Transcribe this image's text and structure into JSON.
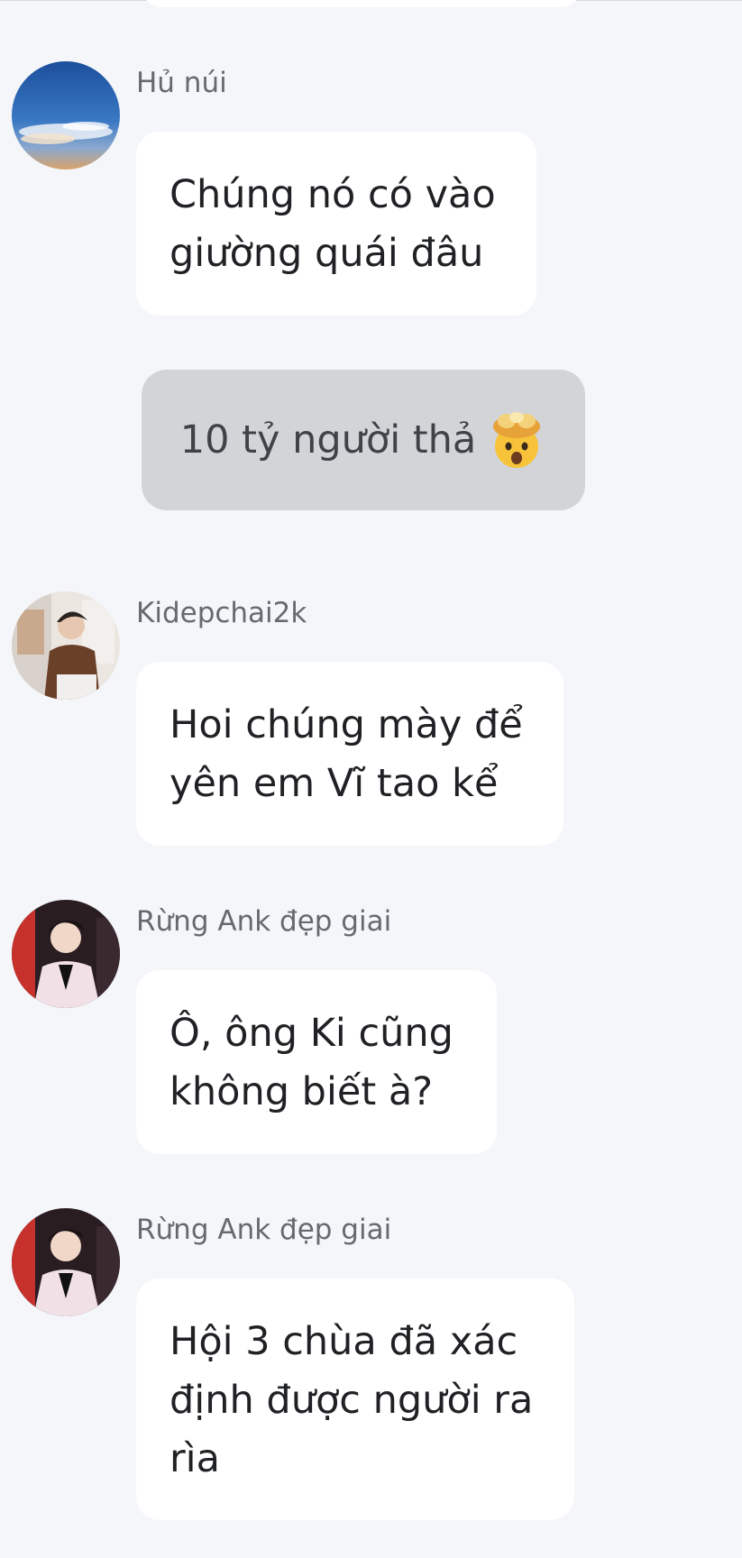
{
  "messages": [
    {
      "sender": "Hủ núi",
      "lines": [
        "Chúng nó có vào",
        "giường quái đâu"
      ]
    },
    {
      "sender": "Kidepchai2k",
      "lines": [
        "Hoi chúng mày để",
        "yên em Vĩ tao kể"
      ]
    },
    {
      "sender": "Rừng Ank đẹp giai",
      "lines": [
        "Ô, ông Ki cũng",
        "không biết à?"
      ]
    },
    {
      "sender": "Rừng Ank đẹp giai",
      "lines": [
        "Hội 3 chùa đã xác",
        "định được người ra",
        "rìa"
      ]
    }
  ],
  "reaction_notice": {
    "text": "10 tỷ người thả",
    "emoji": "exploding-head-emoji"
  },
  "colors": {
    "background": "#f4f6f9",
    "bubble": "#ffffff",
    "reaction_pill": "#d3d4d8",
    "sender_name": "#666a70",
    "message_text": "#1f2124"
  }
}
